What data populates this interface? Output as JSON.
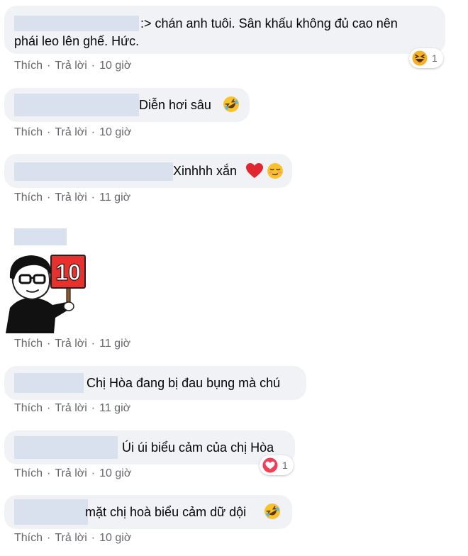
{
  "actions": {
    "like": "Thích",
    "reply": "Trả lời",
    "separator": "·"
  },
  "comments": [
    {
      "text_line1": ":> chán anh tuôi. Sân khấu không đủ cao nên",
      "text_line2": "phái leo lên ghế. Hức.",
      "time": "10 giờ",
      "reaction": {
        "type": "haha",
        "count": "1"
      }
    },
    {
      "text": "Diễn hơi sâu",
      "emoji": "rofl",
      "time": "10 giờ"
    },
    {
      "text": "Xinhhh xắn",
      "emoji": [
        "red-heart",
        "relieved-face"
      ],
      "time": "11 giờ"
    },
    {
      "sticker": "cartoon-man-holding-10-sign",
      "sticker_text": "10",
      "time": "11 giờ"
    },
    {
      "text": "Chị Hòa đang bị đau bụng mà chú",
      "time": "11 giờ"
    },
    {
      "text": "Úi úi biểu cảm của chị Hòa",
      "time": "10 giờ",
      "reaction": {
        "type": "love",
        "count": "1"
      }
    },
    {
      "text": "mặt chị hoà biểu cảm dữ dội",
      "emoji": "rofl",
      "time": "10 giờ"
    }
  ],
  "colors": {
    "bubble": "#f0f2f5",
    "meta_text": "#65676b",
    "love": "#f33e58",
    "sticker_red": "#e8312c"
  }
}
